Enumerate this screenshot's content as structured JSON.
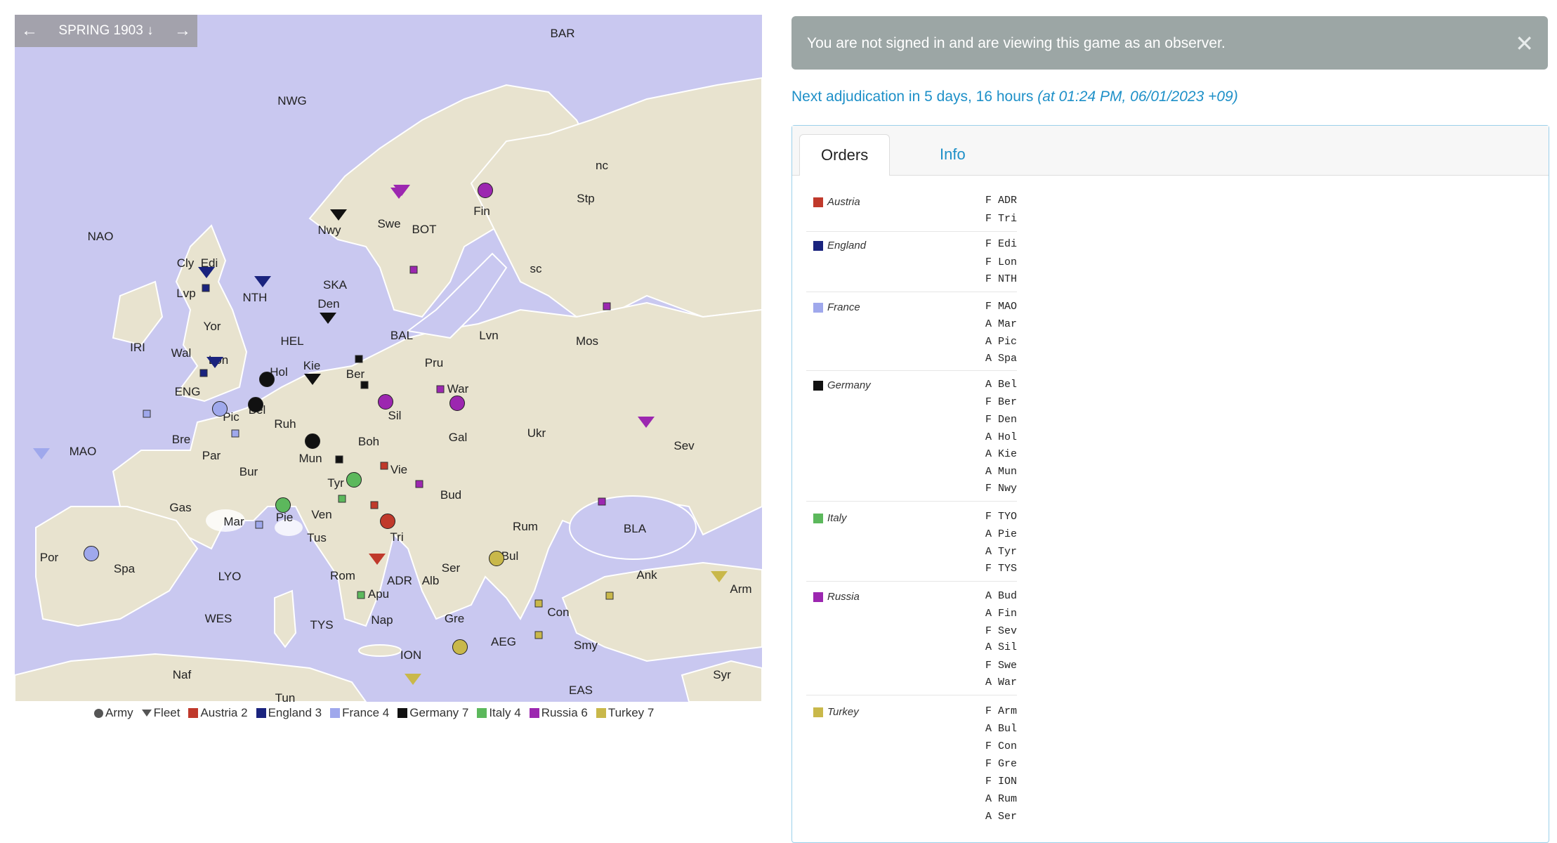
{
  "map": {
    "phase": "SPRING 1903",
    "back_icon": "arrow-left-icon",
    "forward_icon": "arrow-right-icon",
    "colors": {
      "sea": "#c9c8f0",
      "land": "#e8e3cf",
      "border": "#ffffff"
    },
    "provinces": [
      "BAR",
      "NWG",
      "NAO",
      "Cly",
      "Edi",
      "Lvp",
      "NTH",
      "SKA",
      "Nwy",
      "Swe",
      "BOT",
      "Fin",
      "Stp",
      "nc",
      "sc",
      "IRI",
      "Wal",
      "Yor",
      "Lon",
      "ENG",
      "HEL",
      "Den",
      "BAL",
      "Lvn",
      "Mos",
      "Hol",
      "Kie",
      "Ber",
      "Pru",
      "War",
      "Bel",
      "Pic",
      "Ruh",
      "Sil",
      "Mun",
      "Boh",
      "Gal",
      "Ukr",
      "Sev",
      "MAO",
      "Bre",
      "Par",
      "Bur",
      "Tyr",
      "Vie",
      "Bud",
      "Gas",
      "Mar",
      "Pie",
      "Ven",
      "Tri",
      "Rum",
      "BLA",
      "Por",
      "Spa",
      "LYO",
      "Tus",
      "Rom",
      "Apu",
      "ADR",
      "Alb",
      "Ser",
      "Bul",
      "Con",
      "Ank",
      "Arm",
      "WES",
      "TYS",
      "Nap",
      "Gre",
      "AEG",
      "Smy",
      "ION",
      "EAS",
      "Naf",
      "Tun",
      "Syr"
    ]
  },
  "legend": {
    "army": "Army",
    "fleet": "Fleet",
    "powers": [
      {
        "label": "Austria 2",
        "color": "#c0392b"
      },
      {
        "label": "England 3",
        "color": "#1a237e"
      },
      {
        "label": "France 4",
        "color": "#9fa8ec"
      },
      {
        "label": "Germany 7",
        "color": "#111111"
      },
      {
        "label": "Italy 4",
        "color": "#5cb85c"
      },
      {
        "label": "Russia 6",
        "color": "#9c27b0"
      },
      {
        "label": "Turkey 7",
        "color": "#c9b84a"
      }
    ]
  },
  "alert": {
    "message": "You are not signed in and are viewing this game as an observer.",
    "close_icon": "close-icon"
  },
  "deadline": {
    "prefix": "Next adjudication in 5 ",
    "days": "days,",
    "rest": " 16 hours ",
    "italic": "(at 01:24 PM, 06/01/2023 +09)"
  },
  "tabs": {
    "orders": "Orders",
    "info": "Info"
  },
  "powers": [
    {
      "name": "Austria",
      "color": "#c0392b",
      "orders": [
        "F  ADR",
        "F  Tri"
      ]
    },
    {
      "name": "England",
      "color": "#1a237e",
      "orders": [
        "F  Edi",
        "F  Lon",
        "F  NTH"
      ]
    },
    {
      "name": "France",
      "color": "#9fa8ec",
      "orders": [
        "F  MAO",
        "A  Mar",
        "A  Pic",
        "A  Spa"
      ]
    },
    {
      "name": "Germany",
      "color": "#111111",
      "orders": [
        "A  Bel",
        "F  Ber",
        "F  Den",
        "A  Hol",
        "A  Kie",
        "A  Mun",
        "F  Nwy"
      ]
    },
    {
      "name": "Italy",
      "color": "#5cb85c",
      "orders": [
        "F  TYO",
        "A  Pie",
        "A  Tyr",
        "F  TYS"
      ]
    },
    {
      "name": "Russia",
      "color": "#9c27b0",
      "orders": [
        "A  Bud",
        "A  Fin",
        "F  Sev",
        "A  Sil",
        "F  Swe",
        "A  War"
      ]
    },
    {
      "name": "Turkey",
      "color": "#c9b84a",
      "orders": [
        "F  Arm",
        "A  Bul",
        "F  Con",
        "F  Gre",
        "F  ION",
        "A  Rum",
        "A  Ser"
      ]
    }
  ]
}
